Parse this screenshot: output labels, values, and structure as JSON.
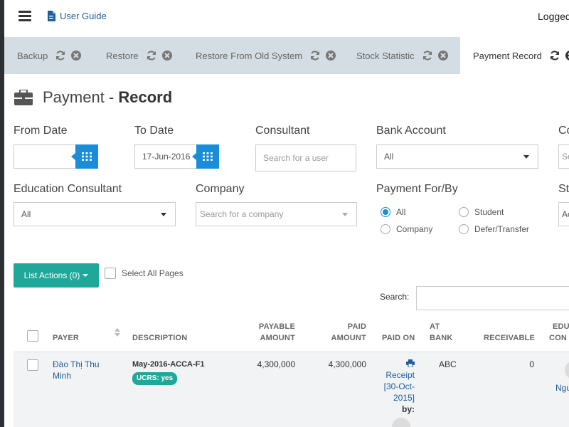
{
  "header": {
    "user_guide": "User Guide",
    "logged": "Logged"
  },
  "tabs": [
    {
      "label": "Backup"
    },
    {
      "label": "Restore"
    },
    {
      "label": "Restore From Old System"
    },
    {
      "label": "Stock Statistic"
    },
    {
      "label": "Payment Record"
    }
  ],
  "page": {
    "title_light": "Payment - ",
    "title_bold": "Record"
  },
  "filters": {
    "from_date": {
      "label": "From Date",
      "value": ""
    },
    "to_date": {
      "label": "To Date",
      "value": "17-Jun-2016"
    },
    "consultant": {
      "label": "Consultant",
      "placeholder": "Search for a user"
    },
    "bank_account": {
      "label": "Bank Account",
      "value": "All"
    },
    "extra_col": {
      "label": "Co",
      "value": "Se"
    },
    "education_consultant": {
      "label": "Education Consultant",
      "value": "All"
    },
    "company": {
      "label": "Company",
      "placeholder": "Search for a company"
    },
    "payment_for": {
      "label": "Payment For/By",
      "options": [
        "All",
        "Student",
        "Company",
        "Defer/Transfer"
      ],
      "selected": "All"
    },
    "extra_col2": {
      "label": "St",
      "value": "Ac"
    }
  },
  "actions": {
    "list_actions": "List Actions (0)",
    "select_all_pages": "Select All Pages",
    "search_label": "Search:"
  },
  "table": {
    "headers": {
      "payer": "PAYER",
      "description": "DESCRIPTION",
      "payable1": "PAYABLE",
      "payable2": "AMOUNT",
      "paid1": "PAID",
      "paid2": "AMOUNT",
      "paid_on": "PAID ON",
      "bank1": "AT",
      "bank2": "BANK",
      "receivable": "RECEIVABLE",
      "edu1": "EDU",
      "edu2": "CON"
    },
    "rows": [
      {
        "payer_line1": "Đào Thị Thu",
        "payer_line2": "Minh",
        "description": "May-2016-ACCA-F1",
        "badge": "UCRS: yes",
        "payable": "4,300,000",
        "paid": "4,300,000",
        "paid_on_line1": "Receipt",
        "paid_on_line2": "[30-Oct-",
        "paid_on_line3": "2015]",
        "paid_on_line4": "by:",
        "bank": "ABC",
        "receivable": "0",
        "edu": "Ngu"
      }
    ]
  },
  "colors": {
    "accent": "#1fa89a",
    "primary": "#1a8cd8",
    "link": "#1f5d99",
    "tabbar": "#d4dde3"
  }
}
